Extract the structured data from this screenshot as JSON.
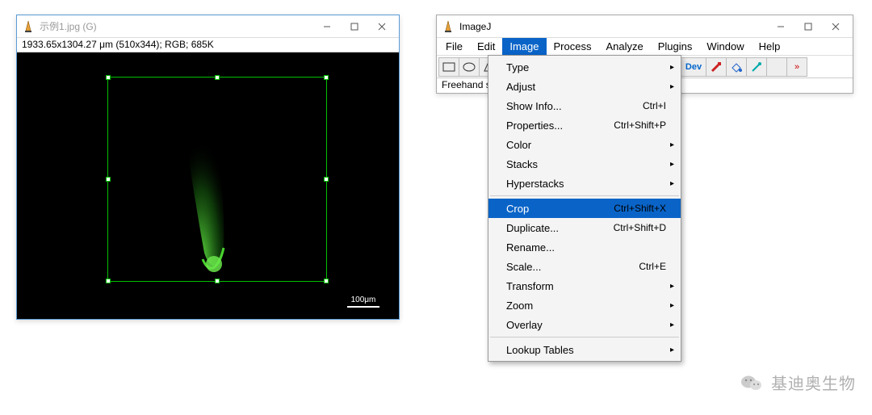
{
  "image_window": {
    "title": "示例1.jpg (G)",
    "info_line": "1933.65x1304.27 μm (510x344); RGB; 685K",
    "scale_label": "100μm"
  },
  "imagej_window": {
    "title": "ImageJ",
    "status": "Freehand sel",
    "menus": [
      "File",
      "Edit",
      "Image",
      "Process",
      "Analyze",
      "Plugins",
      "Window",
      "Help"
    ],
    "active_menu_index": 2,
    "toolbar_dev_label": "Dev"
  },
  "dropdown": {
    "groups": [
      [
        {
          "label": "Type",
          "sub": true
        },
        {
          "label": "Adjust",
          "sub": true
        },
        {
          "label": "Show Info...",
          "shortcut": "Ctrl+I"
        },
        {
          "label": "Properties...",
          "shortcut": "Ctrl+Shift+P"
        },
        {
          "label": "Color",
          "sub": true
        },
        {
          "label": "Stacks",
          "sub": true
        },
        {
          "label": "Hyperstacks",
          "sub": true
        }
      ],
      [
        {
          "label": "Crop",
          "shortcut": "Ctrl+Shift+X",
          "selected": true
        },
        {
          "label": "Duplicate...",
          "shortcut": "Ctrl+Shift+D"
        },
        {
          "label": "Rename..."
        },
        {
          "label": "Scale...",
          "shortcut": "Ctrl+E"
        },
        {
          "label": "Transform",
          "sub": true
        },
        {
          "label": "Zoom",
          "sub": true
        },
        {
          "label": "Overlay",
          "sub": true
        }
      ],
      [
        {
          "label": "Lookup Tables",
          "sub": true
        }
      ]
    ]
  },
  "watermark": {
    "text": "基迪奥生物"
  }
}
